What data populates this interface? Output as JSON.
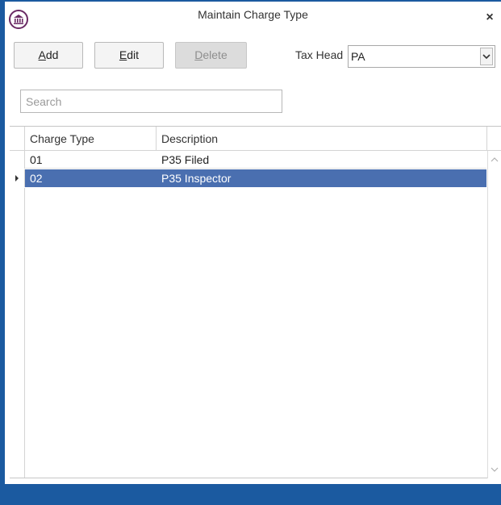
{
  "window": {
    "title": "Maintain Charge Type"
  },
  "toolbar": {
    "add_label": "dd",
    "add_mnemonic": "A",
    "edit_label": "dit",
    "edit_mnemonic": "E",
    "delete_label": "elete",
    "delete_mnemonic": "D",
    "tax_head_label": "Tax Head",
    "tax_head_value": "PA"
  },
  "search": {
    "placeholder": "Search",
    "value": ""
  },
  "grid": {
    "columns": [
      "Charge Type",
      "Description"
    ],
    "rows": [
      {
        "charge_type": "01",
        "description": "P35 Filed",
        "selected": false
      },
      {
        "charge_type": "02",
        "description": "P35 Inspector",
        "selected": true
      }
    ]
  },
  "colors": {
    "accent": "#1b5aa0",
    "selection": "#4a6fb0",
    "app_icon": "#6a2a64"
  },
  "icons": {
    "app": "bank-icon",
    "close": "close-icon",
    "dropdown": "chevron-down-icon",
    "current_row": "row-pointer-icon"
  }
}
